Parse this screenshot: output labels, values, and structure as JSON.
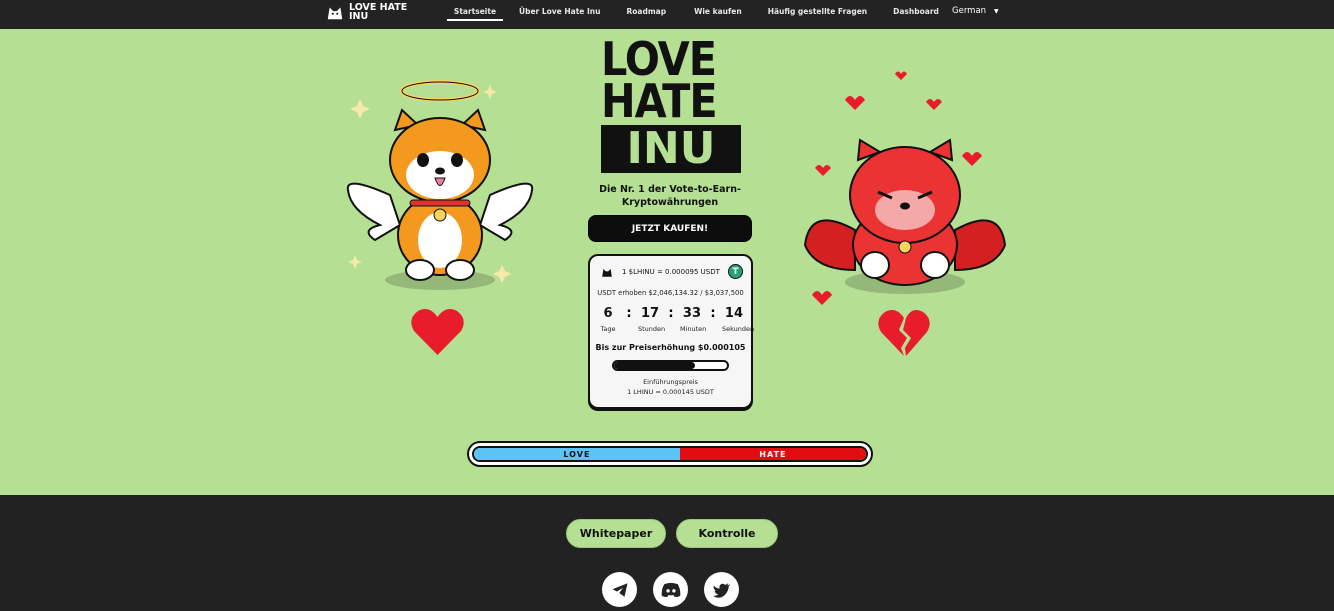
{
  "nav": {
    "brand": "LOVE HATE INU",
    "items": [
      {
        "label": "Startseite",
        "active": true
      },
      {
        "label": "Über Love Hate Inu",
        "active": false
      },
      {
        "label": "Roadmap",
        "active": false
      },
      {
        "label": "Wie kaufen",
        "active": false
      },
      {
        "label": "Häufig gestellte Fragen",
        "active": false
      },
      {
        "label": "Dashboard",
        "active": false
      }
    ],
    "language": "German"
  },
  "hero": {
    "logo_line1": "LOVE",
    "logo_line2": "HATE",
    "logo_line3": "INU",
    "tagline": "Die Nr. 1 der Vote-to-Earn-Kryptowährungen",
    "buy_button": "JETZT KAUFEN!"
  },
  "presale": {
    "rate": "1 $LHINU = 0.000095 USDT",
    "raised": "USDT erhoben $2,046,134.32 / $3,037,500",
    "countdown": [
      {
        "value": "6",
        "label": "Tage"
      },
      {
        "value": "17",
        "label": "Stunden"
      },
      {
        "value": "33",
        "label": "Minuten"
      },
      {
        "value": "14",
        "label": "Sekunden"
      }
    ],
    "next_price": "Bis zur Preiserhöhung $0.000105",
    "progress_fraction": 0.72,
    "intro_label": "Einführungspreis",
    "intro_price": "1 LHINU = 0,000145 USDT"
  },
  "vote": {
    "love_label": "LOVE",
    "hate_label": "HATE",
    "love_fraction": 0.525
  },
  "footer": {
    "buttons": [
      "Whitepaper",
      "Kontrolle"
    ],
    "socials": [
      "telegram-icon",
      "discord-icon",
      "twitter-icon"
    ]
  },
  "colors": {
    "hero_bg": "#b5e094",
    "love": "#5bc4f5",
    "hate": "#e10d10",
    "dark": "#222222"
  }
}
